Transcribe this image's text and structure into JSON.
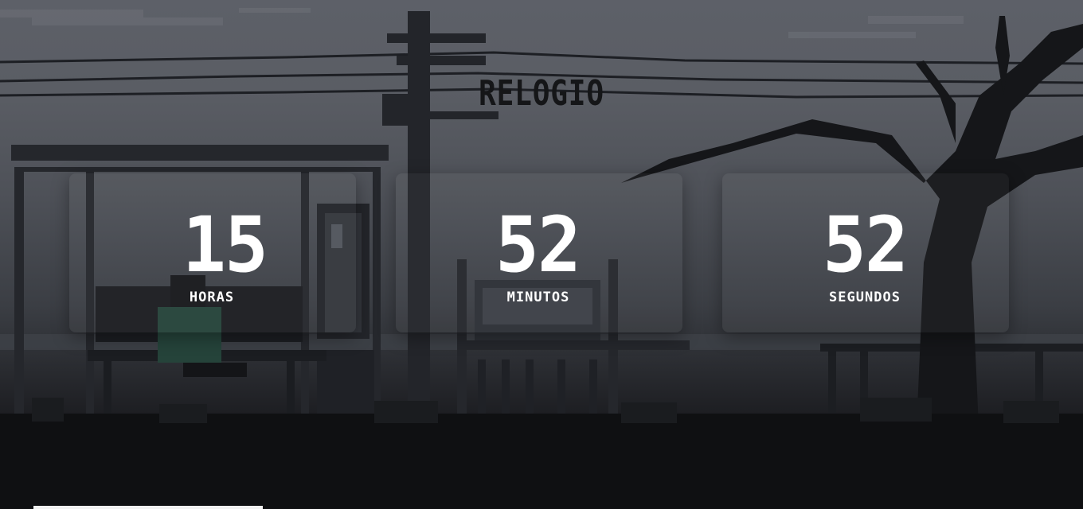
{
  "title": "RELOGIO",
  "clock": {
    "hours": {
      "value": "15",
      "label": "HORAS"
    },
    "minutes": {
      "value": "52",
      "label": "MINUTOS"
    },
    "seconds": {
      "value": "52",
      "label": "SEGUNDOS"
    }
  },
  "colors": {
    "sky": "#5d6068",
    "ground": "#0b0b0d",
    "silhouette": "#1e2024",
    "text": "#ffffff",
    "title": "#151618"
  }
}
